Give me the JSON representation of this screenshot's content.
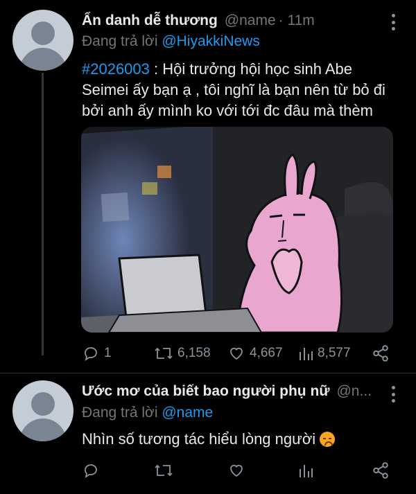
{
  "tweet1": {
    "display_name": "Ẩn danh dễ thương",
    "handle": "@name",
    "time": "· 11m",
    "replying_prefix": "Đang trả lời",
    "replying_to": "@HiyakkiNews",
    "hashtag": "#2026003",
    "text": " : Hội trưởng hội học sinh Abe Seimei ấy bạn ạ , tôi nghĩ là bạn nên từ bỏ đi bởi anh ấy mình ko với tới đc đâu mà thèm",
    "media_icon": "illustration-pink-rabbit-at-laptop",
    "actions": {
      "reply_count": "1",
      "retweet_count": "6,158",
      "like_count": "4,667",
      "views_count": "8,577"
    }
  },
  "tweet2": {
    "display_name": "Ước mơ của biết bao người phụ nữ",
    "handle": "@n...",
    "replying_prefix": "Đang trả lời",
    "replying_to": "@name",
    "text": "Nhìn số tương tác hiểu lòng người",
    "emoji": "disappointed-face-emoji"
  },
  "colors": {
    "background": "#000000",
    "text": "#e7e9ea",
    "muted": "#71767b",
    "accent": "#1d9bf0",
    "avatar": "#c4cdd6"
  }
}
